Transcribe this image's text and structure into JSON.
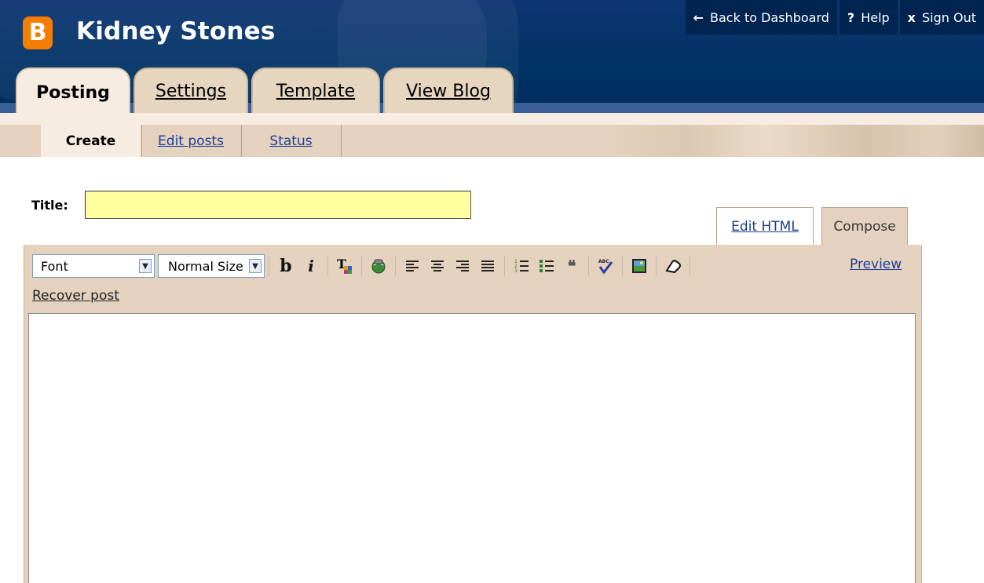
{
  "blog": {
    "title": "Kidney Stones",
    "logo_letter": "B"
  },
  "topnav": {
    "back": {
      "icon": "←",
      "label": "Back to Dashboard"
    },
    "help": {
      "icon": "?",
      "label": "Help"
    },
    "signout": {
      "icon": "x",
      "label": "Sign Out"
    }
  },
  "tabs": [
    {
      "label": "Posting",
      "active": true
    },
    {
      "label": "Settings",
      "active": false
    },
    {
      "label": "Template",
      "active": false
    },
    {
      "label": "View Blog",
      "active": false
    }
  ],
  "subnav": [
    {
      "label": "Create",
      "active": true
    },
    {
      "label": "Edit posts",
      "active": false
    },
    {
      "label": "Status",
      "active": false
    }
  ],
  "post": {
    "title_label": "Title:",
    "title_value": ""
  },
  "modes": {
    "edit_html": "Edit HTML",
    "compose": "Compose"
  },
  "toolbar": {
    "font_select": "Font",
    "size_select": "Normal Size",
    "buttons": [
      "bold-icon",
      "italic-icon",
      "text-color-icon",
      "link-icon",
      "align-left-icon",
      "align-center-icon",
      "align-right-icon",
      "align-justify-icon",
      "numbered-list-icon",
      "bullet-list-icon",
      "blockquote-icon",
      "spellcheck-icon",
      "image-icon",
      "eraser-icon"
    ],
    "bold_glyph": "b",
    "italic_glyph": "i",
    "preview": "Preview",
    "recover": "Recover post"
  },
  "colors": {
    "header": "#003366",
    "tab_bg": "#e6d6c0",
    "accent_link": "#1a3d9a",
    "title_input": "#ffffa0",
    "logo": "#f57d00"
  }
}
